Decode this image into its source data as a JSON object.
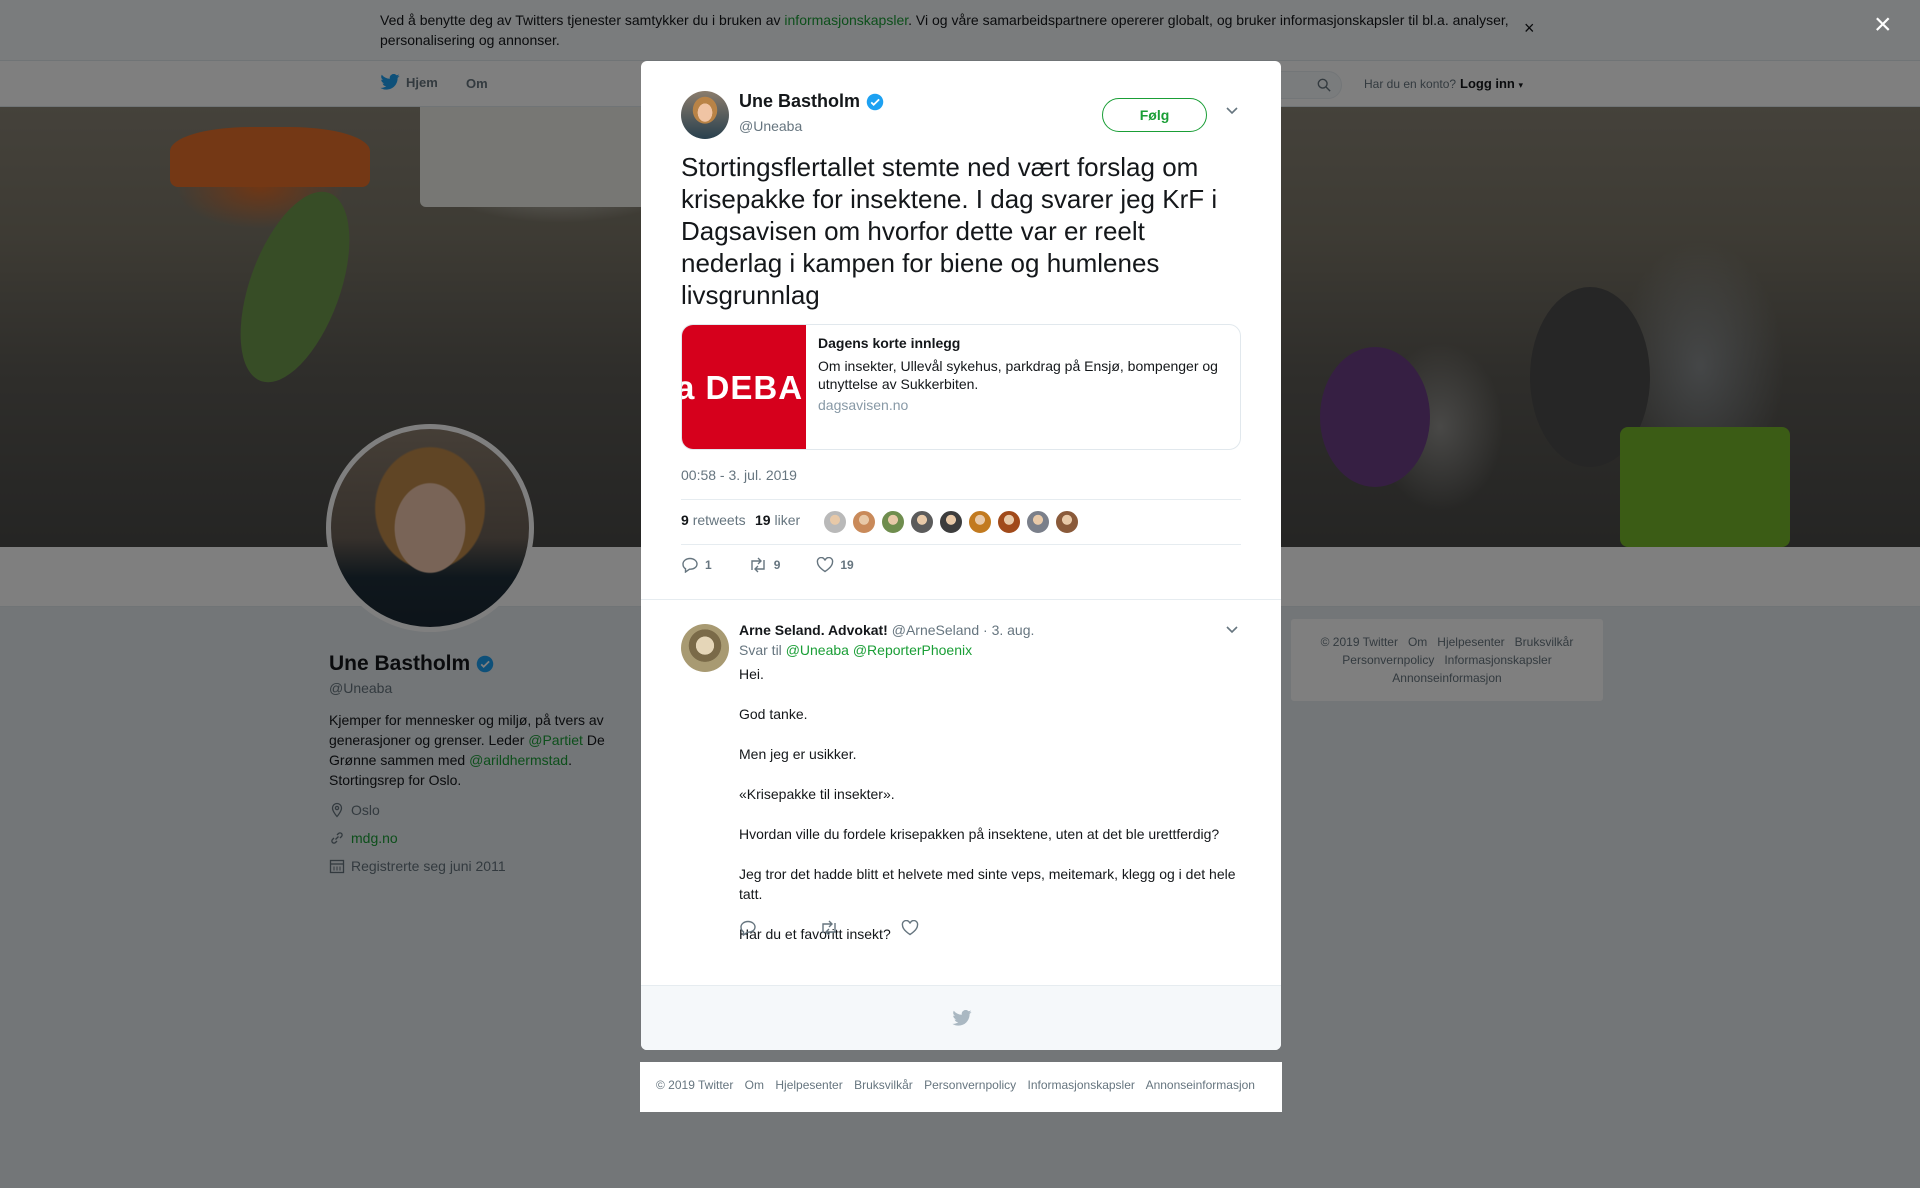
{
  "cookie": {
    "text_before": "Ved å benytte deg av Twitters tjenester samtykker du i bruken av ",
    "link": "informasjonskapsler",
    "text_after": ". Vi og våre samarbeidspartnere opererer globalt, og bruker informasjonskapsler til bl.a. analyser, personalisering og annonser.",
    "close": "×"
  },
  "nav": {
    "home": "Hjem",
    "about": "Om",
    "account_prompt": "Har du en konto?",
    "login": "Logg inn"
  },
  "profile": {
    "name": "Une Bastholm",
    "handle": "@Uneaba",
    "bio_1": "Kjemper for mennesker og miljø, på tvers av generasjoner og grenser. Leder ",
    "bio_link_1": "@Partiet",
    "bio_2": " De Grønne sammen med ",
    "bio_link_2": "@arildhermstad",
    "bio_3": ". Stortingsrep for Oslo.",
    "location": "Oslo",
    "website": "mdg.no",
    "joined": "Registrerte seg juni 2011"
  },
  "side_footer": {
    "links": [
      "© 2019 Twitter",
      "Om",
      "Hjelpesenter",
      "Bruksvilkår",
      "Personvernpolicy",
      "Informasjonskapsler",
      "Annonseinformasjon"
    ]
  },
  "modal": {
    "close": "×",
    "author_name": "Une Bastholm",
    "author_handle": "@Uneaba",
    "follow_label": "Følg",
    "tweet_text": "Stortingsflertallet stemte ned vært forslag om krisepakke for insektene. I dag svarer jeg KrF i Dagsavisen om hvorfor dette var er reelt nederlag i kampen for biene og humlenes livsgrunnlag",
    "card": {
      "image_text": "a DEBA",
      "title": "Dagens korte innlegg",
      "description": "Om insekter, Ullevål sykehus, parkdrag på Ensjø, bompenger og utnyttelse av Sukkerbiten.",
      "domain": "dagsavisen.no"
    },
    "timestamp": "00:58 - 3. jul. 2019",
    "retweets_count": "9",
    "retweets_label": "retweets",
    "likes_count": "19",
    "likes_label": "liker",
    "liker_colors": [
      "#b9b9b9",
      "#c98a5a",
      "#6f8d4e",
      "#5b5b5b",
      "#3d3d3d",
      "#c27a1f",
      "#a14a1a",
      "#7a7f8a",
      "#8a5a3a"
    ],
    "actions": {
      "reply": "1",
      "retweet": "9",
      "like": "19"
    }
  },
  "reply": {
    "name": "Arne Seland. Advokat!",
    "handle": "@ArneSeland",
    "date": "· 3. aug.",
    "reply_to_label": "Svar til",
    "reply_to_1": "@Uneaba",
    "reply_to_2": "@ReporterPhoenix",
    "lines": [
      "Hei.",
      "God tanke.",
      "Men jeg er usikker.",
      "«Krisepakke til insekter».",
      "Hvordan ville du fordele krisepakken på insektene, uten at det ble urettferdig?",
      "Jeg tror det hadde blitt et helvete med sinte veps, meitemark, klegg og i det hele tatt.",
      "Har du et favoritt insekt?"
    ]
  },
  "bottom_footer": {
    "links": [
      "© 2019 Twitter",
      "Om",
      "Hjelpesenter",
      "Bruksvilkår",
      "Personvernpolicy",
      "Informasjonskapsler",
      "Annonseinformasjon"
    ]
  },
  "colors": {
    "accent": "#1a9e36",
    "verified": "#1da1f2",
    "card_image": "#d6001c"
  }
}
